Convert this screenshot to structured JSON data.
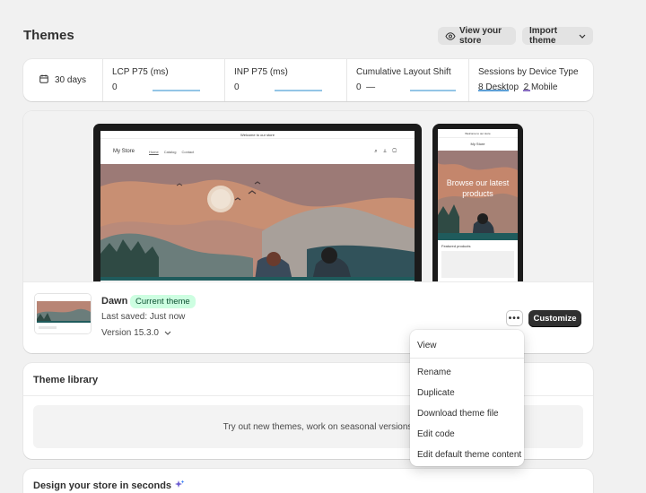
{
  "header": {
    "title": "Themes",
    "view_store_label": "View your store",
    "import_theme_label": "Import theme"
  },
  "metrics": {
    "range_label": "30 days",
    "lcp": {
      "label": "LCP P75 (ms)",
      "value": "0"
    },
    "inp": {
      "label": "INP P75 (ms)",
      "value": "0"
    },
    "cls": {
      "label": "Cumulative Layout Shift",
      "value": "0",
      "trend": "—"
    },
    "sessions": {
      "label": "Sessions by Device Type",
      "desktop_count": "8",
      "desktop_label": "Desktop",
      "mobile_count": "2",
      "mobile_label": "Mobile"
    }
  },
  "preview": {
    "announcement": "Welcome to our store",
    "store_name": "My Store",
    "nav": [
      "Home",
      "Catalog",
      "Contact"
    ],
    "mobile_hero_text": "Browse our latest products",
    "featured_label": "Featured products"
  },
  "current_theme": {
    "name": "Dawn",
    "badge": "Current theme",
    "last_saved": "Last saved: Just now",
    "version": "Version 15.3.0",
    "customize_label": "Customize",
    "more_label": "•••"
  },
  "library": {
    "title": "Theme library",
    "empty_text": "Try out new themes, work on seasonal versions, or test changes to you"
  },
  "design": {
    "title": "Design your store in seconds"
  },
  "menu": {
    "items": [
      "View",
      "Rename",
      "Duplicate",
      "Download theme file",
      "Edit code",
      "Edit default theme content"
    ]
  },
  "colors": {
    "accent_dark": "#303030",
    "badge_bg": "#cdfee1",
    "badge_text": "#0c5132",
    "metric_line": "#93c5e6"
  }
}
